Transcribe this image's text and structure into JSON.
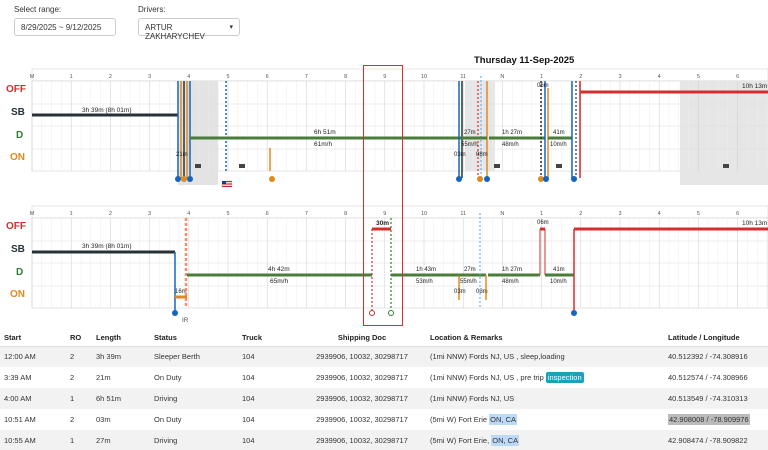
{
  "filters": {
    "range_label": "Select range:",
    "range_value": "8/29/2025 ~ 9/12/2025",
    "drivers_label": "Drivers:",
    "driver_value": "ARTUR ZAKHARYCHEV"
  },
  "chart_date": "Thursday 11-Sep-2025",
  "status_labels": {
    "off": "OFF",
    "sb": "SB",
    "d": "D",
    "on": "ON"
  },
  "hour_labels": [
    "M",
    "1",
    "2",
    "3",
    "4",
    "5",
    "6",
    "7",
    "8",
    "9",
    "10",
    "11",
    "N",
    "1",
    "2",
    "3",
    "4",
    "5",
    "6"
  ],
  "upper_annotations": {
    "sb_duration": "3h 39m (8h 01m)",
    "d_duration": "6h 51m",
    "d_speed": "61m/h",
    "on_short": "21m",
    "mid_d1": "27m",
    "mid_d1_speed": "55m/h",
    "mid_on_03": "03m",
    "mid_on_08": "08m",
    "d2": "1h 27m",
    "d2_speed": "48m/h",
    "d3": "41m",
    "d3_speed": "10m/h",
    "off_06": "06m",
    "off_long": "10h 13m"
  },
  "lower_annotations": {
    "sb_duration": "3h 39m (8h 01m)",
    "on_short": "16m",
    "d1": "4h 42m",
    "d1_speed": "65m/h",
    "off_30": "30m",
    "d2": "1h 43m",
    "d2_speed": "53m/h",
    "d3": "27m",
    "d3_speed": "55m/h",
    "on_03": "03m",
    "on_08": "08m",
    "d4": "1h 27m",
    "d4_speed": "48m/h",
    "off_06": "06m",
    "d5": "41m",
    "d5_speed": "10m/h",
    "off_long": "10h 13m",
    "ir_label": "IR"
  },
  "colors": {
    "off": "#d32f2f",
    "sb": "#263238",
    "driving": "#4a7c3a",
    "on": "#e08a1e",
    "highlight_box": "#d32f2f"
  },
  "table": {
    "headers": [
      "Start",
      "RO",
      "Length",
      "Status",
      "Truck",
      "Shipping Doc",
      "Location & Remarks",
      "Latitude / Longitude"
    ],
    "rows": [
      {
        "start": "12:00 AM",
        "ro": "2",
        "length": "3h 39m",
        "status": "Sleeper Berth",
        "truck": "104",
        "doc": "2939906, 10032, 30298717",
        "loc_pre": "(1mi NNW) Fords NJ, US , sleep,loading",
        "loc_hl": "",
        "loc_post": "",
        "latlng": "40.512392 / -74.308916"
      },
      {
        "start": "3:39 AM",
        "ro": "2",
        "length": "21m",
        "status": "On Duty",
        "truck": "104",
        "doc": "2939906, 10032, 30298717",
        "loc_pre": "(1mi NNW) Fords NJ, US , pre trip ",
        "loc_hl": "inspection",
        "loc_post": "",
        "latlng": "40.512574 / -74.308966"
      },
      {
        "start": "4:00 AM",
        "ro": "1",
        "length": "6h 51m",
        "status": "Driving",
        "truck": "104",
        "doc": "2939906, 10032, 30298717",
        "loc_pre": "(1mi NNW) Fords NJ, US",
        "loc_hl": "",
        "loc_post": "",
        "latlng": "40.513549 / -74.310313"
      },
      {
        "start": "10:51 AM",
        "ro": "2",
        "length": "03m",
        "status": "On Duty",
        "truck": "104",
        "doc": "2939906, 10032, 30298717",
        "loc_pre": "(5mi W) Fort Erie ",
        "loc_hl": "ON, CA",
        "loc_post": "",
        "latlng": "42.908008 / -78.909976"
      },
      {
        "start": "10:55 AM",
        "ro": "1",
        "length": "27m",
        "status": "Driving",
        "truck": "104",
        "doc": "2939906, 10032, 30298717",
        "loc_pre": "(5mi W) Fort Erie, ",
        "loc_hl": "ON, CA",
        "loc_post": "",
        "latlng": "42.908474 / -78.909822"
      }
    ]
  }
}
